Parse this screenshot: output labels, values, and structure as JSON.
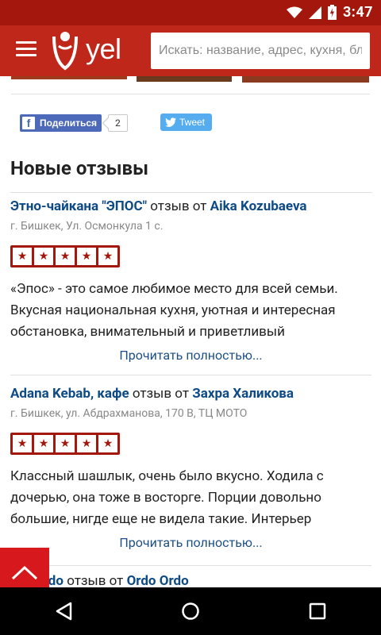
{
  "status_bar": {
    "time": "3:47"
  },
  "app_bar": {
    "logo_text": "yel",
    "search": {
      "placeholder": "Искать: название, адрес, кухня, бл",
      "value": ""
    }
  },
  "share": {
    "facebook_label": "Поделиться",
    "facebook_count": "2",
    "twitter_label": "Tweet"
  },
  "section": {
    "title": "Новые отзывы"
  },
  "reviews": [
    {
      "place": "Этно-чайкана \"ЭПОС\"",
      "by_text": "отзыв от",
      "author": "Aika Kozubaeva",
      "address": "г. Бишкек, Ул. Осмонкула 1 с.",
      "rating": 5,
      "text": "«Эпос» - это самое любимое место для всей семьи. Вкусная национальная кухня, уютная и интересная обстановка, внимательный и приветливый",
      "read_more": "Прочитать полностью..."
    },
    {
      "place": "Adana Kebab, кафе",
      "by_text": "отзыв от",
      "author": "Захра Халикова",
      "address": "г. Бишкек, ул. Абдрахманова, 170 В, ТЦ МОТО",
      "rating": 5,
      "text": "Классный шашлык, очень было вкусно. Ходила с дочерью, она тоже в восторге. Порции довольно большие, нигде еще не видела такие. Интерьер",
      "read_more": "Прочитать полностью..."
    },
    {
      "place": "Ordo",
      "by_text": "отзыв от",
      "author": "Ordo Ordo"
    }
  ],
  "colors": {
    "primary": "#c0271b",
    "status": "#a3170c",
    "link": "#0d4a86",
    "facebook": "#4c69ba",
    "twitter": "#55acee",
    "back_top": "#d7191d"
  }
}
